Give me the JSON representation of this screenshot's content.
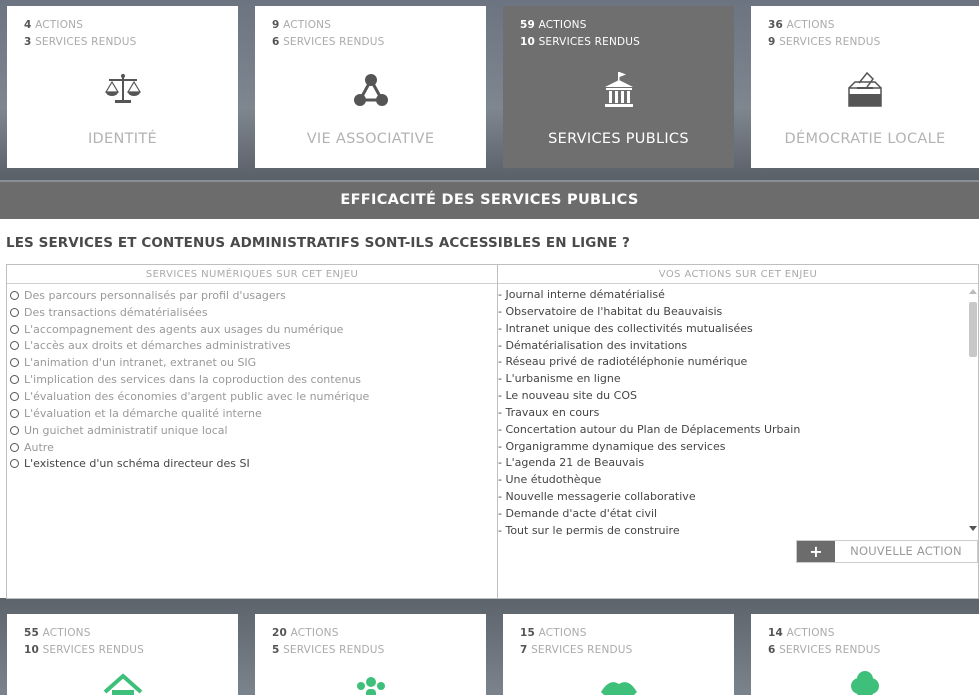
{
  "top_cards": [
    {
      "actions_count": "4",
      "actions_label": "ACTIONS",
      "services_count": "3",
      "services_label": "SERVICES RENDUS",
      "title": "IDENTITÉ",
      "icon": "scales-icon",
      "active": false
    },
    {
      "actions_count": "9",
      "actions_label": "ACTIONS",
      "services_count": "6",
      "services_label": "SERVICES RENDUS",
      "title": "VIE ASSOCIATIVE",
      "icon": "network-icon",
      "active": false
    },
    {
      "actions_count": "59",
      "actions_label": "ACTIONS",
      "services_count": "10",
      "services_label": "SERVICES RENDUS",
      "title": "SERVICES PUBLICS",
      "icon": "town-hall-icon",
      "active": true
    },
    {
      "actions_count": "36",
      "actions_label": "ACTIONS",
      "services_count": "9",
      "services_label": "SERVICES RENDUS",
      "title": "DÉMOCRATIE LOCALE",
      "icon": "ballot-box-icon",
      "active": false
    }
  ],
  "section_title": "EFFICACITÉ DES SERVICES PUBLICS",
  "question": "LES SERVICES ET CONTENUS ADMINISTRATIFS SONT-ILS ACCESSIBLES EN LIGNE ?",
  "left_header": "SERVICES NUMÉRIQUES SUR CET ENJEU",
  "right_header": "VOS ACTIONS SUR CET ENJEU",
  "services": [
    "Des parcours personnalisés par profil d'usagers",
    "Des transactions dématérialisées",
    "L'accompagnement des agents aux usages du numérique",
    "L'accès aux droits et démarches administratives",
    "L'animation d'un intranet, extranet ou SIG",
    "L'implication des services dans la coproduction des contenus",
    "L'évaluation des économies d'argent public avec le numérique",
    "L'évaluation et la démarche qualité interne",
    "Un guichet administratif unique local",
    "Autre",
    "L'existence d'un schéma directeur des SI"
  ],
  "actions": [
    "- Journal interne dématérialisé",
    "- Observatoire de l'habitat du Beauvaisis",
    "- Intranet unique des collectivités mutualisées",
    "- Dématérialisation des invitations",
    "- Réseau privé de radiotéléphonie numérique",
    "- L'urbanisme en ligne",
    "- Le nouveau site du COS",
    "- Travaux en cours",
    "- Concertation autour du Plan de Déplacements Urbain",
    "- Organigramme dynamique des services",
    "- L'agenda 21 de Beauvais",
    "- Une étudothèque",
    "- Nouvelle messagerie collaborative",
    "- Demande d'acte d'état civil",
    "- Tout sur le permis de construire"
  ],
  "new_action_button": {
    "icon": "+",
    "label": "NOUVELLE ACTION"
  },
  "bottom_cards": [
    {
      "actions_count": "55",
      "actions_label": "ACTIONS",
      "services_count": "10",
      "services_label": "SERVICES RENDUS",
      "icon": "house-icon"
    },
    {
      "actions_count": "20",
      "actions_label": "ACTIONS",
      "services_count": "5",
      "services_label": "SERVICES RENDUS",
      "icon": "people-icon"
    },
    {
      "actions_count": "15",
      "actions_label": "ACTIONS",
      "services_count": "7",
      "services_label": "SERVICES RENDUS",
      "icon": "handshake-icon"
    },
    {
      "actions_count": "14",
      "actions_label": "ACTIONS",
      "services_count": "6",
      "services_label": "SERVICES RENDUS",
      "icon": "tree-icon"
    }
  ],
  "colors": {
    "accent_green": "#3ec07a",
    "band_gray": "#6c6c6c"
  }
}
